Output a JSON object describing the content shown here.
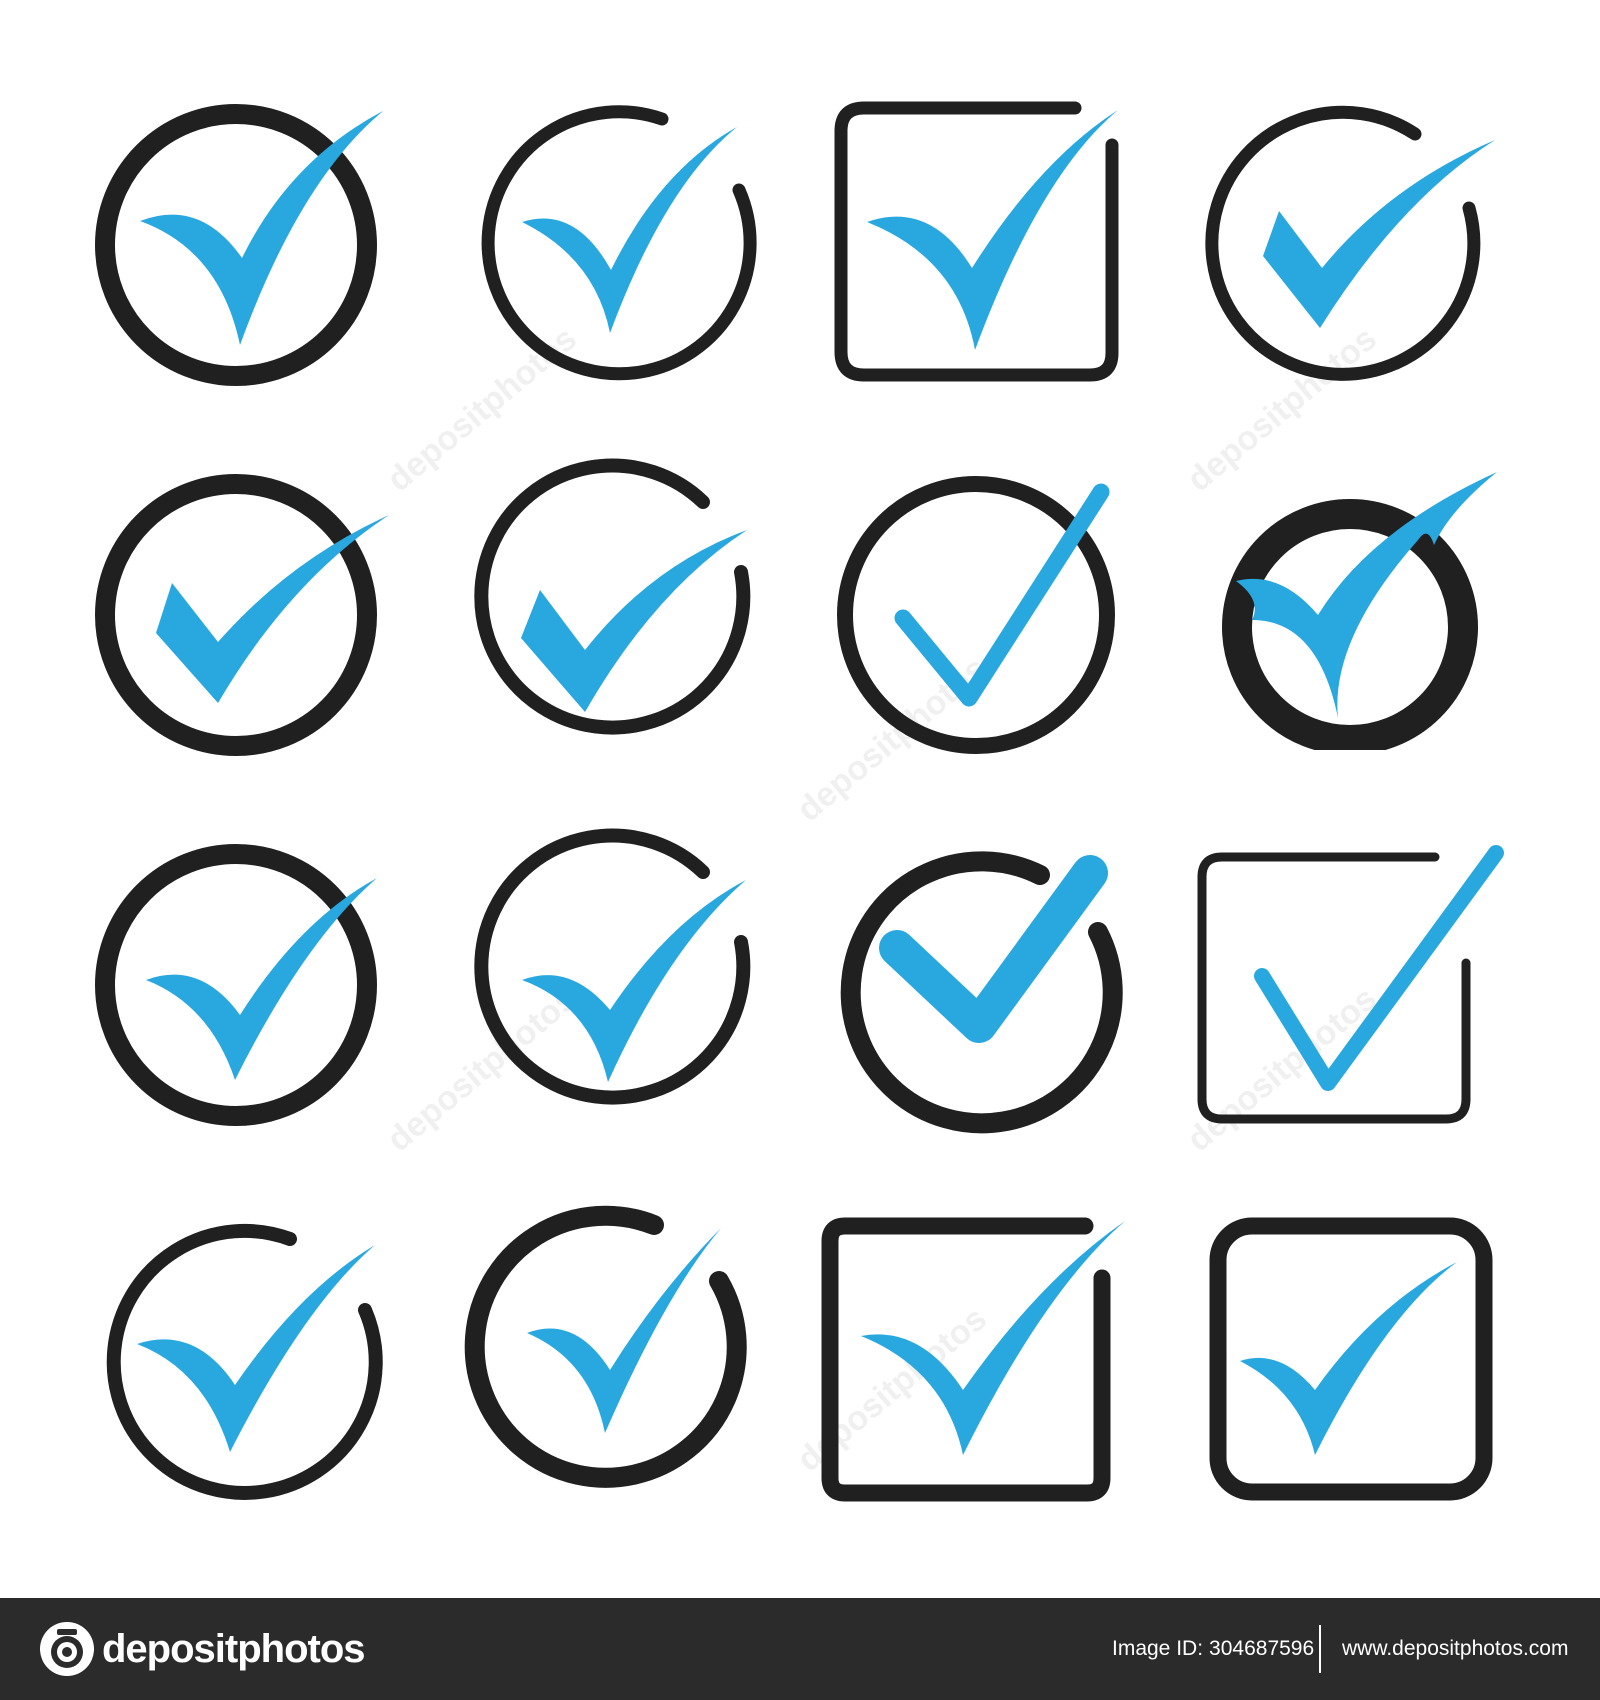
{
  "colors": {
    "outline": "#202020",
    "check": "#29a8e0",
    "background": "#ffffff",
    "footer_bg": "#2b2b2b",
    "footer_text": "#ffffff"
  },
  "watermark": {
    "text": "depositphotos"
  },
  "icons": [
    "check-circle-icon",
    "check-circle-icon",
    "check-square-icon",
    "check-circle-icon",
    "check-circle-icon",
    "check-circle-icon",
    "check-circle-icon",
    "check-circle-icon",
    "check-circle-icon",
    "check-circle-icon",
    "check-circle-icon",
    "check-square-icon",
    "check-circle-icon",
    "check-circle-icon",
    "check-square-icon",
    "check-square-icon"
  ],
  "footer": {
    "brand_name": "depositphotos",
    "image_id_label": "Image ID:",
    "image_id_value": "304687596",
    "site_url": "www.depositphotos.com"
  }
}
